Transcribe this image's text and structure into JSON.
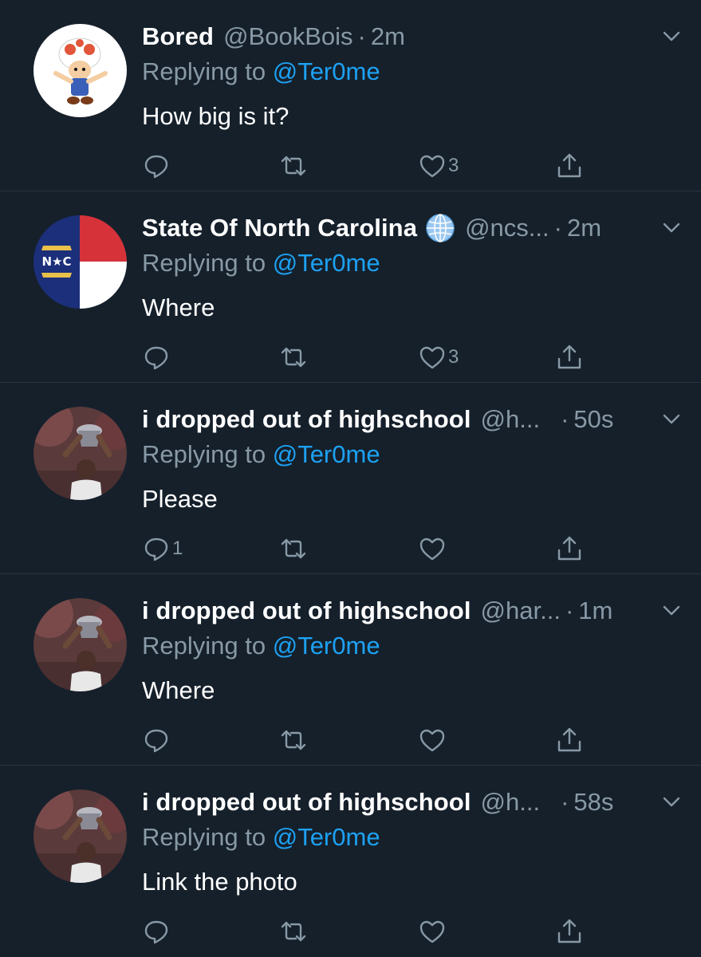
{
  "colors": {
    "background": "#15202b",
    "divider": "#2a3541",
    "text_primary": "#ffffff",
    "text_secondary": "#8899a6",
    "link": "#1da1f2"
  },
  "labels": {
    "replying_to": "Replying to"
  },
  "tweets": [
    {
      "name": "Bored",
      "handle": "@BookBois",
      "separator": "·",
      "time": "2m",
      "mention": "@Ter0me",
      "text": "How big is it?",
      "reply_count": "",
      "retweet_count": "",
      "like_count": "3",
      "avatar_icon": "toad-avatar"
    },
    {
      "name": "State Of North Carolina",
      "handle": "@ncs...",
      "separator": "·",
      "time": "2m",
      "mention": "@Ter0me",
      "text": "Where",
      "reply_count": "",
      "retweet_count": "",
      "like_count": "3",
      "avatar_icon": "nc-flag-avatar",
      "badge_icon": "globe-icon"
    },
    {
      "name": "i dropped out of highschool",
      "handle": "@h...",
      "separator": "·",
      "time": "50s",
      "mention": "@Ter0me",
      "text": "Please",
      "reply_count": "1",
      "retweet_count": "",
      "like_count": "",
      "avatar_icon": "trophy-player-avatar"
    },
    {
      "name": "i dropped out of highschool",
      "handle": "@har...",
      "separator": "·",
      "time": "1m",
      "mention": "@Ter0me",
      "text": "Where",
      "reply_count": "",
      "retweet_count": "",
      "like_count": "",
      "avatar_icon": "trophy-player-avatar"
    },
    {
      "name": "i dropped out of highschool",
      "handle": "@h...",
      "separator": "·",
      "time": "58s",
      "mention": "@Ter0me",
      "text": "Link the photo",
      "reply_count": "",
      "retweet_count": "",
      "like_count": "",
      "avatar_icon": "trophy-player-avatar"
    }
  ]
}
